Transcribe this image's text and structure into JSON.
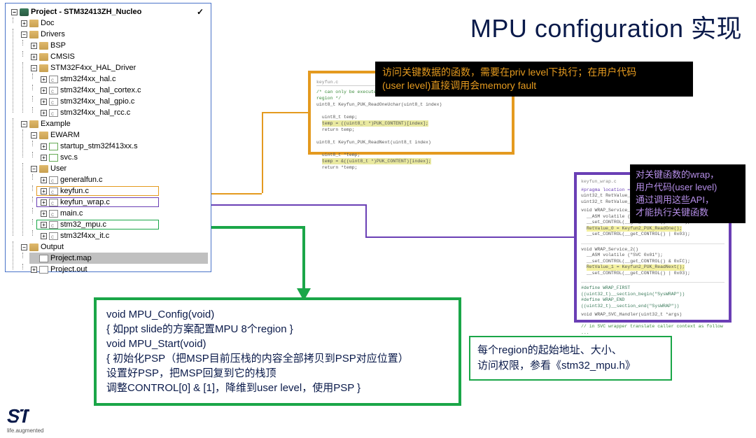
{
  "title": "MPU configuration 实现",
  "tree": {
    "root_label": "Project - STM32413ZH_Nucleo",
    "root_checked": "✓",
    "doc": "Doc",
    "drivers": "Drivers",
    "bsp": "BSP",
    "cmsis": "CMSIS",
    "hal_driver_folder": "STM32F4xx_HAL_Driver",
    "hal_c": "stm32f4xx_hal.c",
    "hal_cortex_c": "stm32f4xx_hal_cortex.c",
    "hal_gpio_c": "stm32f4xx_hal_gpio.c",
    "hal_rcc_c": "stm32f4xx_hal_rcc.c",
    "example": "Example",
    "ewarm": "EWARM",
    "startup_s": "startup_stm32f413xx.s",
    "svc_s": "svc.s",
    "user": "User",
    "generalfun_c": "generalfun.c",
    "keyfun_c": "keyfun.c",
    "keyfun_wrap_c": "keyfun_wrap.c",
    "main_c": "main.c",
    "stm32_mpu_c": "stm32_mpu.c",
    "stm32f4xx_it_c": "stm32f4xx_it.c",
    "output": "Output",
    "project_map": "Project.map",
    "project_out": "Project.out"
  },
  "orange_code": {
    "file_tab": "keyfun.c",
    "comment": "/* can only be executed in privileged mode as PSP is protected by MPU region */",
    "sig": "uint8_t Keyfun_PUK_ReadOneUchar(uint8_t index)",
    "body1": "uint8_t temp;",
    "body2": "temp = ((uint8_t *)PUK_CONTENT)[index];",
    "body3": "return temp;",
    "sig2": "uint8_t Keyfun_PUK_ReadNext(uint8_t index)",
    "body4": "uint8_t *temp;",
    "body5": "temp = &((uint8_t *)PUK_CONTENT)[index];",
    "body6": "return *temp;"
  },
  "orange_note_l1": "访问关键数据的函数，需要在priv level下执行；在用户代码",
  "orange_note_l2": "(user level)直接调用会memory fault",
  "purple_code": {
    "file_tab": "keyfun_wrap.c",
    "pragma1": "#pragma location = \"SysMEM\"",
    "pragma2": "uint32_t RetValue_0 = 0;",
    "pragma3": "uint32_t RetValue_1 = 0;",
    "fn1_sig": "void WRAP_Service_1()",
    "asm1": "__ASM volatile (\"SVC 0x01\");",
    "asm2": "__set_CONTROL(__get_CONTROL() & 0xFC);",
    "asm3": "RetValue_0 = Keyfun2_PUK_ReadOne();",
    "asm4": "__set_CONTROL(__get_CONTROL() | 0x03);",
    "fn2_sig": "void WRAP_Service_2()",
    "asm5": "__ASM volatile (\"SVC 0x01\");",
    "asm6": "__set_CONTROL(__get_CONTROL() & 0xFC);",
    "asm7": "RetValue_1 = Keyfun2_PUK_ReadNext();",
    "asm8": "__set_CONTROL(__get_CONTROL() | 0x03);",
    "def1": "#define WRAP_FIRST        ((uint32_t)__section_begin(\"SysWRAP\"))",
    "def2": "#define WRAP_END          ((uint32_t)__section_end(\"SysWRAP\"))",
    "fn3_sig": "void WRAP_SVC_Handler(uint32_t *args)",
    "tail": "// in SVC wrapper translate caller context as follow ..."
  },
  "purple_note_l1": "对关键函数的wrap，",
  "purple_note_l2": "用户代码(user level)",
  "purple_note_l3": "通过调用这些API，",
  "purple_note_l4": "才能执行关键函数",
  "green_box": {
    "l1": "void MPU_Config(void)",
    "l2": "{ 如ppt slide的方案配置MPU 8个region }",
    "l3": "",
    "l4": "void MPU_Start(void)",
    "l5": "{ 初始化PSP（把MSP目前压栈的内容全部拷贝到PSP对应位置）",
    "l6": "  设置好PSP，把MSP回复到它的栈顶",
    "l7": "  调整CONTROL[0] & [1]，降维到user level，使用PSP }"
  },
  "green_note_l1": "每个region的起始地址、大小、",
  "green_note_l2": "访问权限，参看《stm32_mpu.h》",
  "logo_mark": "ST",
  "logo_tag": "life.augmented"
}
